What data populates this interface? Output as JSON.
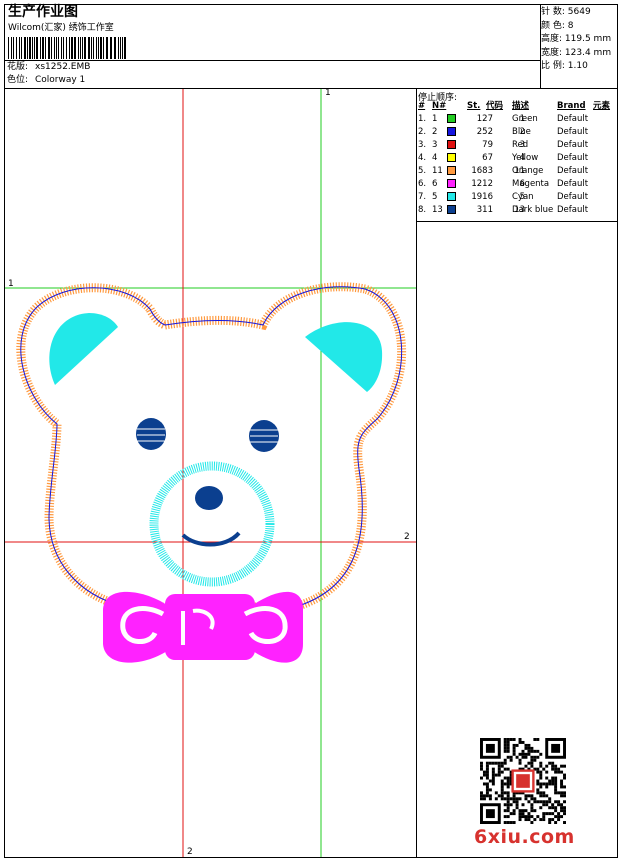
{
  "header": {
    "title": "生产作业图",
    "studio": "Wilcom(汇家) 绣饰工作室",
    "design_label": "花版:",
    "design_value": "xs1252.EMB",
    "colorway_label": "色位:",
    "colorway_value": "Colorway 1"
  },
  "stats": {
    "stitches_label": "针 数:",
    "stitches_value": "5649",
    "colors_label": "颜 色:",
    "colors_value": "8",
    "height_label": "高度:",
    "height_value": "119.5 mm",
    "width_label": "宽度:",
    "width_value": "123.4 mm",
    "scale_label": "比 例:",
    "scale_value": "1.10"
  },
  "stop_sequence": {
    "title": "停止顺序:",
    "columns": [
      "#",
      "N#",
      "St.",
      "代码",
      "描述",
      "Brand",
      "元素"
    ],
    "rows": [
      {
        "num": "1.",
        "n": "1",
        "color": "#22cc22",
        "st": "127",
        "code": "1",
        "desc": "Green",
        "brand": "Default"
      },
      {
        "num": "2.",
        "n": "2",
        "color": "#1515e0",
        "st": "252",
        "code": "2",
        "desc": "Blue",
        "brand": "Default"
      },
      {
        "num": "3.",
        "n": "3",
        "color": "#e01010",
        "st": "79",
        "code": "3",
        "desc": "Red",
        "brand": "Default"
      },
      {
        "num": "4.",
        "n": "4",
        "color": "#ffff00",
        "st": "67",
        "code": "4",
        "desc": "Yellow",
        "brand": "Default"
      },
      {
        "num": "5.",
        "n": "11",
        "color": "#ff9a40",
        "st": "1683",
        "code": "11",
        "desc": "Orange",
        "brand": "Default"
      },
      {
        "num": "6.",
        "n": "6",
        "color": "#ff22ff",
        "st": "1212",
        "code": "6",
        "desc": "Magenta",
        "brand": "Default"
      },
      {
        "num": "7.",
        "n": "5",
        "color": "#22e8e8",
        "st": "1916",
        "code": "5",
        "desc": "Cyan",
        "brand": "Default"
      },
      {
        "num": "8.",
        "n": "13",
        "color": "#0b3f8f",
        "st": "311",
        "code": "13",
        "desc": "Dark blue",
        "brand": "Default"
      }
    ]
  },
  "guides": {
    "green_top": "1",
    "green_left": "1",
    "red_right": "2",
    "red_bottom": "2"
  },
  "colors": {
    "guide_green": "#22cc22",
    "guide_red": "#e01010",
    "outline_orange": "#ff9a40",
    "outline_blue": "#1515e0",
    "ear_cyan": "#22e8e8",
    "eye_darkblue": "#0b3f8f",
    "bow_magenta": "#ff22ff",
    "watermark_red": "#d7322e"
  },
  "watermark": "6xiu.com"
}
